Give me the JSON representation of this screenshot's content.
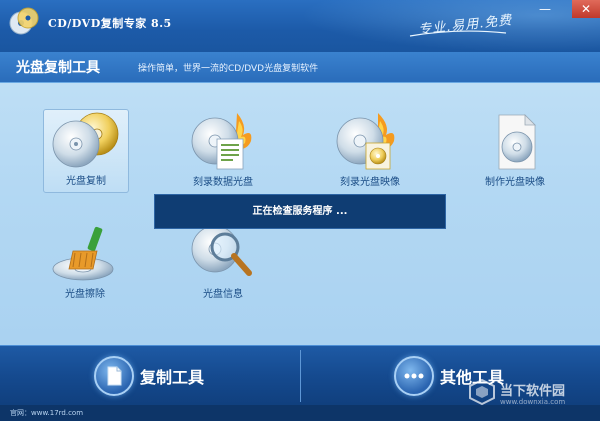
{
  "window": {
    "title": "CD/DVD复制专家 8.5",
    "slogan": "专业.易用.免费",
    "minimize_symbol": "—",
    "close_symbol": "✕"
  },
  "section": {
    "title": "光盘复制工具",
    "description": "操作简单，世界一流的CD/DVD光盘复制软件"
  },
  "tools": [
    {
      "label": "光盘复制",
      "icon": "disc-copy-icon",
      "selected": true
    },
    {
      "label": "刻录数据光盘",
      "icon": "burn-data-disc-icon"
    },
    {
      "label": "刻录光盘映像",
      "icon": "burn-disc-image-icon"
    },
    {
      "label": "制作光盘映像",
      "icon": "make-disc-image-icon"
    },
    {
      "label": "光盘擦除",
      "icon": "disc-erase-icon"
    },
    {
      "label": "光盘信息",
      "icon": "disc-info-icon"
    }
  ],
  "status": {
    "message": "正在检查服务程序 ..."
  },
  "bottom": {
    "copy_tools_label": "复制工具",
    "other_tools_label": "其他工具"
  },
  "watermark": {
    "name": "当下软件园",
    "url": "www.downxia.com"
  },
  "statusbar": {
    "site": "官网：www.17rd.com"
  },
  "colors": {
    "accent": "#1c5aa8",
    "status_box": "#0f3d73",
    "bottom_bar": "#154a8f"
  }
}
